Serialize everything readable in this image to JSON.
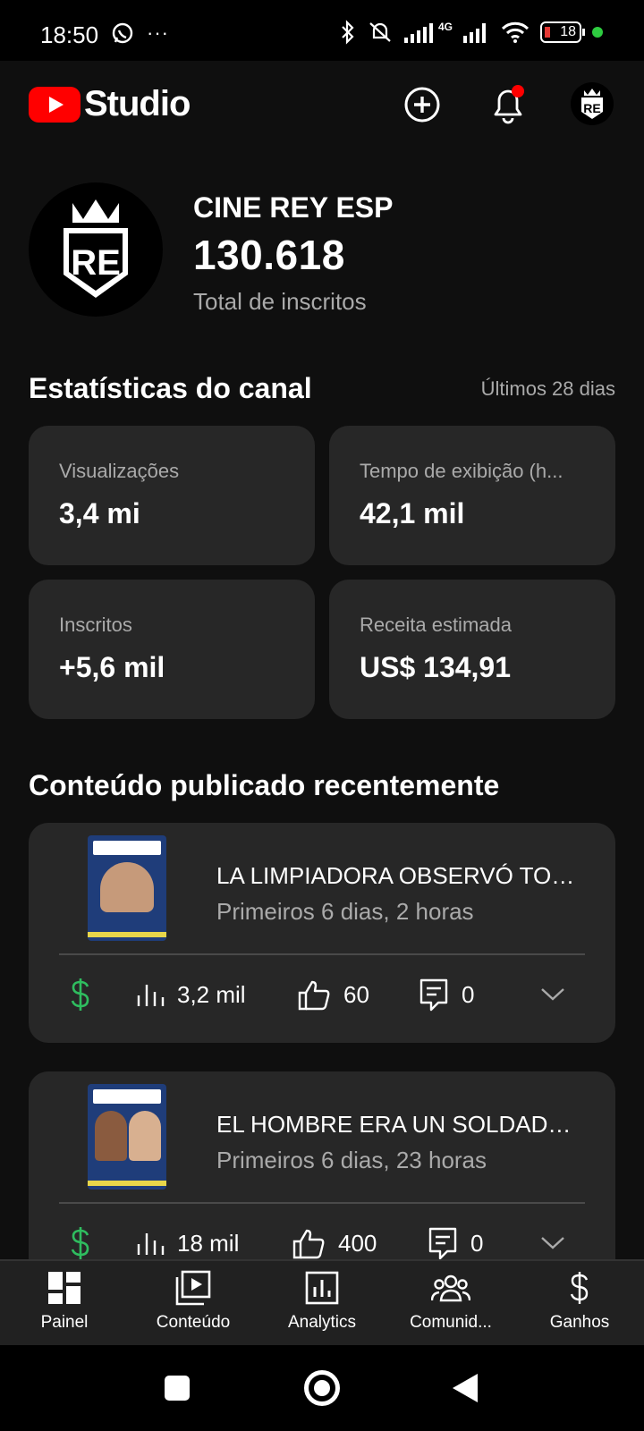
{
  "status_bar": {
    "time": "18:50",
    "battery": "18",
    "signal": "4G"
  },
  "header": {
    "app_title": "Studio"
  },
  "channel": {
    "name": "CINE REY ESP",
    "subscribers": "130.618",
    "subscribers_label": "Total de inscritos",
    "avatar_text": "RE"
  },
  "stats": {
    "title": "Estatísticas do canal",
    "period": "Últimos 28 dias",
    "cards": [
      {
        "label": "Visualizações",
        "value": "3,4 mi"
      },
      {
        "label": "Tempo de exibição (h...",
        "value": "42,1 mil"
      },
      {
        "label": "Inscritos",
        "value": "+5,6 mil"
      },
      {
        "label": "Receita estimada",
        "value": "US$ 134,91"
      }
    ]
  },
  "recent": {
    "title": "Conteúdo publicado recentemente",
    "videos": [
      {
        "title": "LA LIMPIADORA OBSERVÓ TOD...",
        "subtitle": "Primeiros 6 dias, 2 horas",
        "views": "3,2 mil",
        "likes": "60",
        "comments": "0"
      },
      {
        "title": "EL HOMBRE ERA UN SOLDADO ...",
        "subtitle": "Primeiros 6 dias, 23 horas",
        "views": "18 mil",
        "likes": "400",
        "comments": "0"
      }
    ]
  },
  "bottom_nav": {
    "items": [
      {
        "label": "Painel",
        "icon": "dashboard-icon"
      },
      {
        "label": "Conteúdo",
        "icon": "content-icon"
      },
      {
        "label": "Analytics",
        "icon": "analytics-icon"
      },
      {
        "label": "Comunid...",
        "icon": "community-icon"
      },
      {
        "label": "Ganhos",
        "icon": "earn-icon"
      }
    ]
  },
  "colors": {
    "brand_red": "#ff0000",
    "money_green": "#2fbd5f",
    "card_bg": "#272727"
  }
}
